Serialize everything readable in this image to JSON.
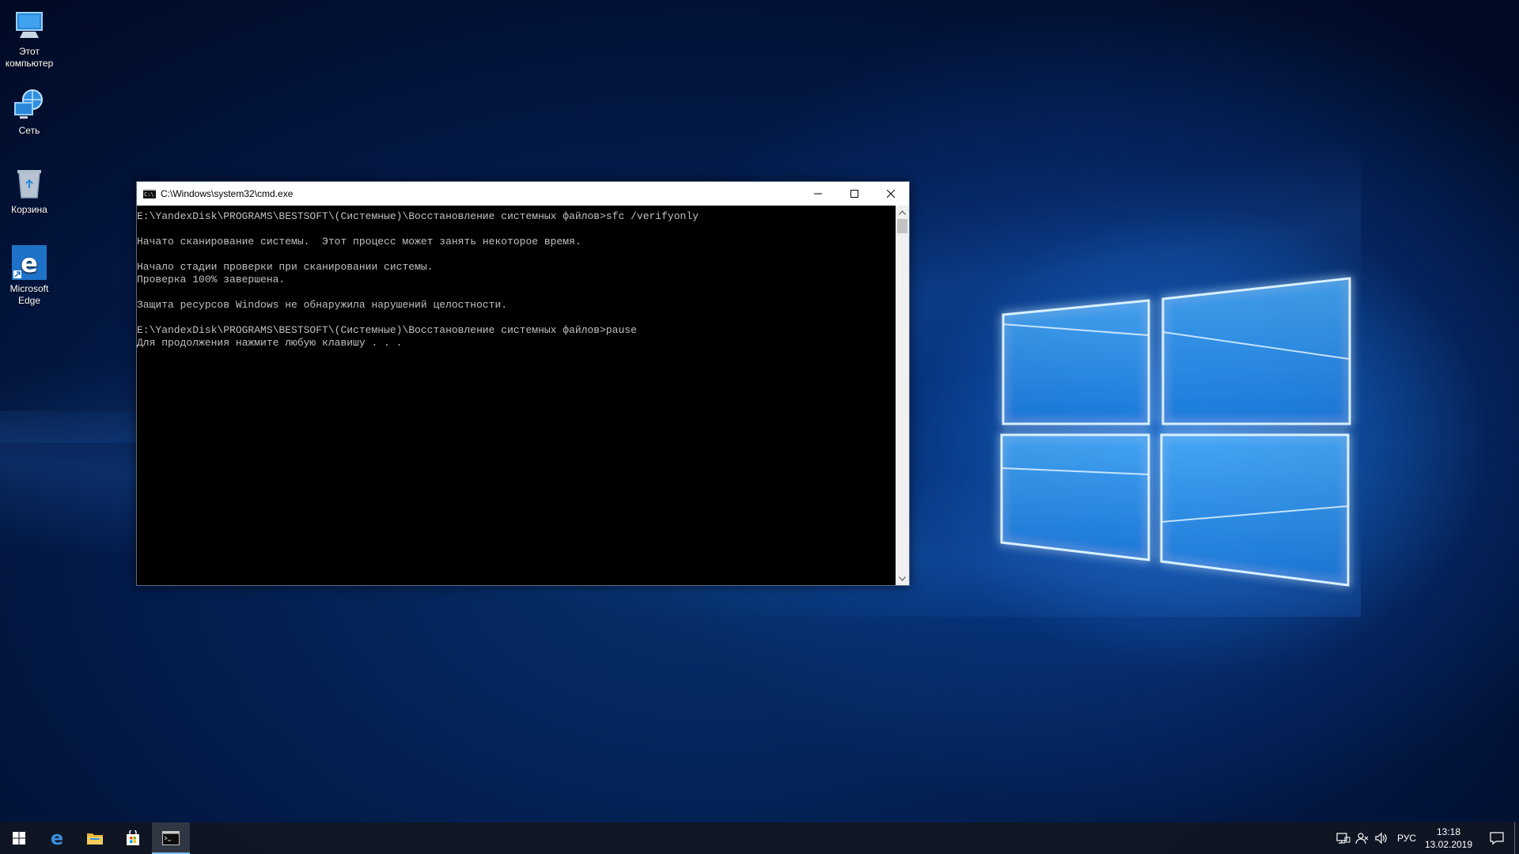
{
  "desktop": {
    "icons": [
      {
        "label_line1": "Этот",
        "label_line2": "компьютер",
        "icon": "this-pc-icon"
      },
      {
        "label_line1": "Сеть",
        "label_line2": "",
        "icon": "network-icon"
      },
      {
        "label_line1": "Корзина",
        "label_line2": "",
        "icon": "recycle-bin-icon"
      },
      {
        "label_line1": "Microsoft",
        "label_line2": "Edge",
        "icon": "edge-icon"
      }
    ]
  },
  "cmd_window": {
    "title": "C:\\Windows\\system32\\cmd.exe",
    "console_text": "E:\\YandexDisk\\PROGRAMS\\BESTSOFT\\(Системные)\\Восстановление системных файлов>sfc /verifyonly\n\nНачато сканирование системы.  Этот процесс может занять некоторое время.\n\nНачало стадии проверки при сканировании системы.\nПроверка 100% завершена.\n\nЗащита ресурсов Windows не обнаружила нарушений целостности.\n\nE:\\YandexDisk\\PROGRAMS\\BESTSOFT\\(Системные)\\Восстановление системных файлов>pause\nДля продолжения нажмите любую клавишу . . .",
    "colors": {
      "background": "#000000",
      "text": "#c0c0c0"
    }
  },
  "taskbar": {
    "items": [
      "start-icon",
      "edge-icon",
      "file-explorer-icon",
      "store-icon",
      "cmd-icon"
    ],
    "active_item": "cmd-icon",
    "tray": {
      "language": "РУС",
      "time": "13:18",
      "date": "13.02.2019"
    },
    "accent": "#76b9ed"
  }
}
